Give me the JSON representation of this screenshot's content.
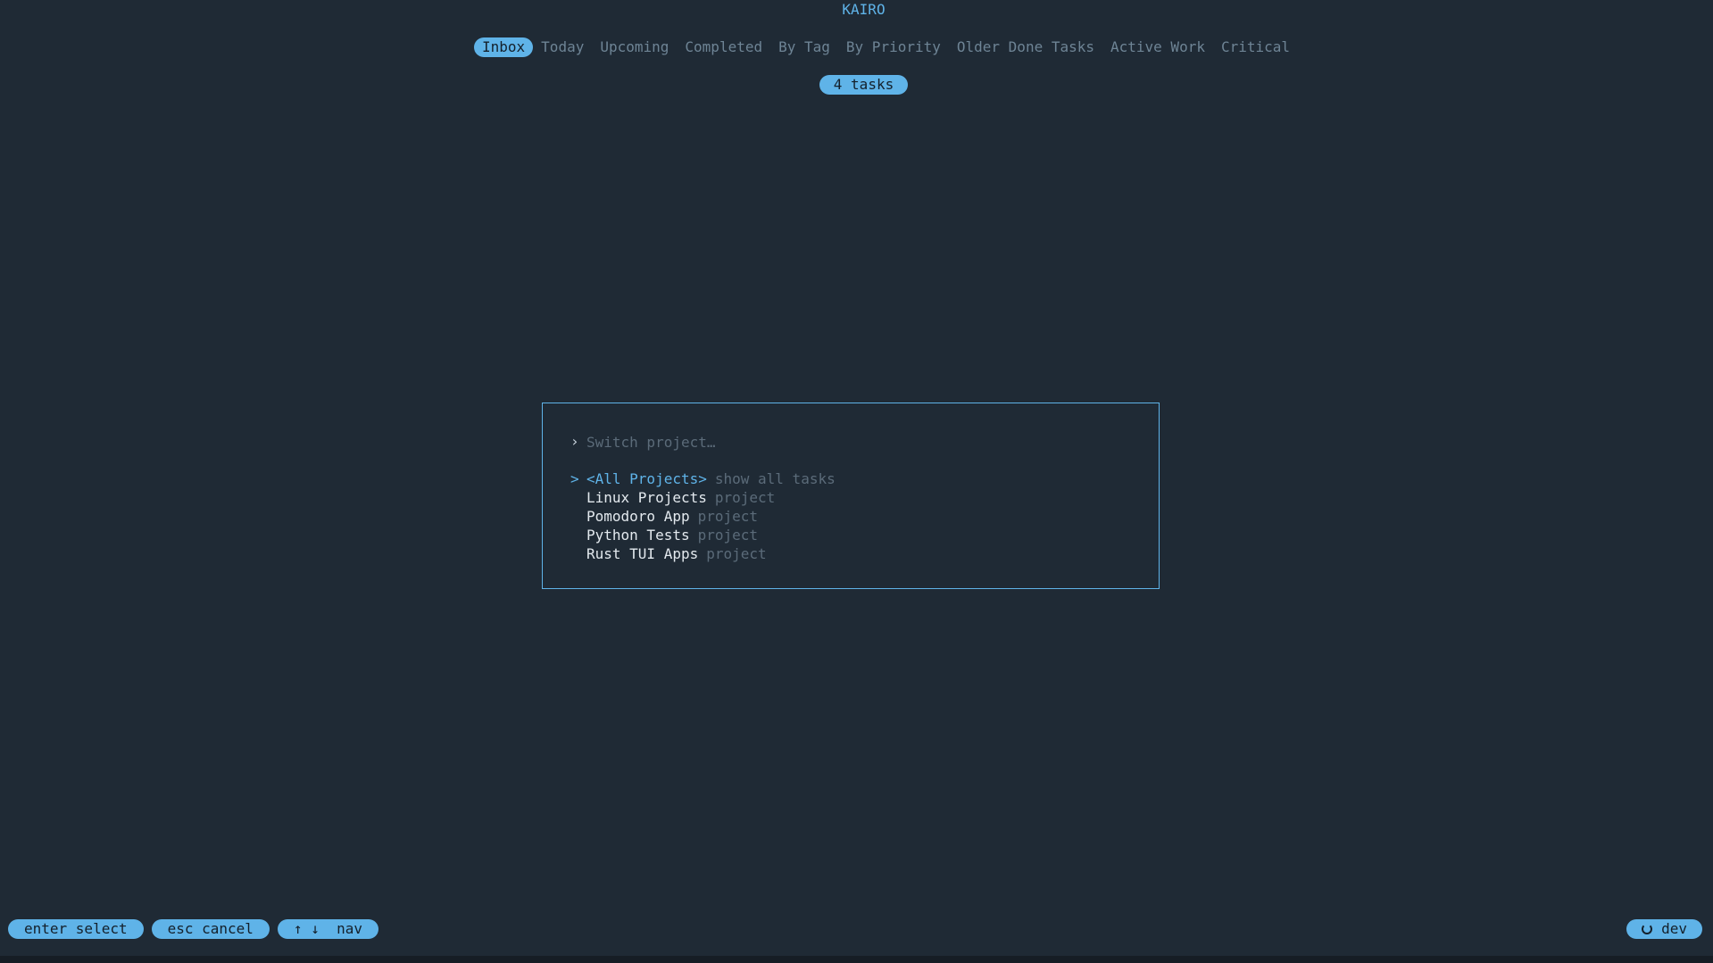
{
  "app": {
    "title": "KAIRO"
  },
  "tabs": [
    {
      "label": "Inbox",
      "active": true
    },
    {
      "label": "Today",
      "active": false
    },
    {
      "label": "Upcoming",
      "active": false
    },
    {
      "label": "Completed",
      "active": false
    },
    {
      "label": "By Tag",
      "active": false
    },
    {
      "label": "By Priority",
      "active": false
    },
    {
      "label": "Older Done Tasks",
      "active": false
    },
    {
      "label": "Active Work",
      "active": false
    },
    {
      "label": "Critical",
      "active": false
    }
  ],
  "task_count": "4 tasks",
  "project_switcher": {
    "prompt_glyph": "›",
    "search": {
      "value": "",
      "placeholder": "Switch project…"
    },
    "cursor_glyph": ">",
    "items": [
      {
        "name": "<All Projects>",
        "desc": "show all tasks",
        "selected": true
      },
      {
        "name": "Linux Projects",
        "desc": "project",
        "selected": false
      },
      {
        "name": "Pomodoro App",
        "desc": "project",
        "selected": false
      },
      {
        "name": "Python Tests",
        "desc": "project",
        "selected": false
      },
      {
        "name": "Rust TUI Apps",
        "desc": "project",
        "selected": false
      }
    ]
  },
  "footer": {
    "keys": [
      {
        "label": "enter select"
      },
      {
        "label": "esc cancel"
      },
      {
        "label": "↑ ↓  nav"
      }
    ],
    "env": {
      "icon": "sync-icon",
      "label": "dev"
    }
  },
  "colors": {
    "background": "#1f2a35",
    "accent": "#5fb3e8",
    "muted": "#6e8495",
    "dim": "#5b6b79"
  }
}
